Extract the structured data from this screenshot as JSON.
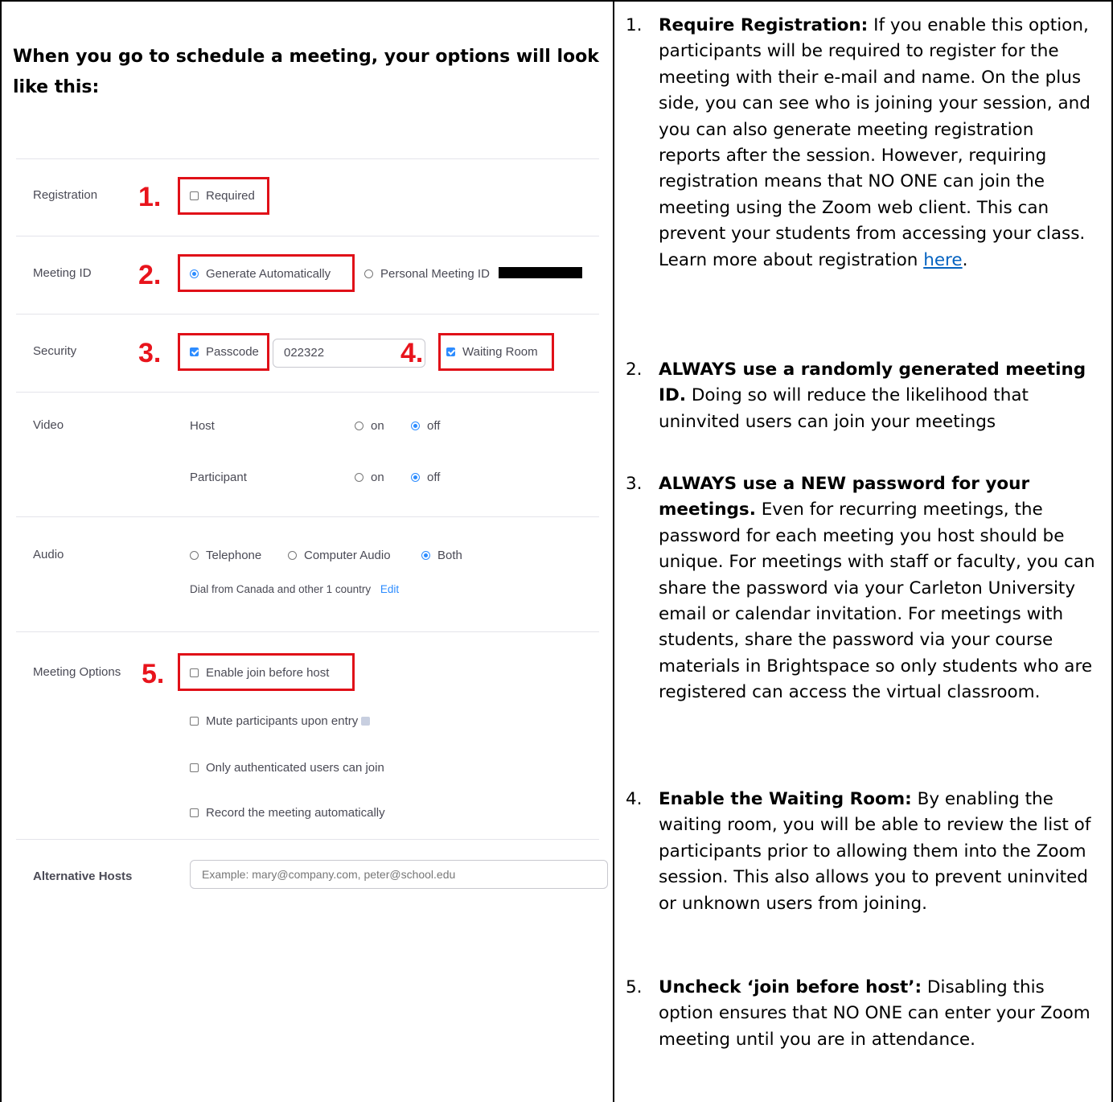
{
  "intro": "When you go to schedule a meeting, your options will look like this:",
  "zoom": {
    "registration": {
      "label": "Registration",
      "num": "1.",
      "option": "Required"
    },
    "meeting_id": {
      "label": "Meeting ID",
      "num": "2.",
      "auto": "Generate Automatically",
      "personal": "Personal Meeting ID"
    },
    "security": {
      "label": "Security",
      "num3": "3.",
      "passcode": "Passcode",
      "passcode_value": "022322",
      "num4": "4.",
      "waiting": "Waiting Room"
    },
    "video": {
      "label": "Video",
      "host": "Host",
      "participant": "Participant",
      "on": "on",
      "off": "off"
    },
    "audio": {
      "label": "Audio",
      "telephone": "Telephone",
      "computer": "Computer Audio",
      "both": "Both",
      "dial_text": "Dial from Canada and other 1 country",
      "edit": "Edit"
    },
    "meeting_options": {
      "label": "Meeting Options",
      "num": "5.",
      "join_before": "Enable join before host",
      "mute": "Mute participants upon entry",
      "auth": "Only authenticated users can join",
      "record": "Record the meeting automatically"
    },
    "alt_hosts": {
      "label": "Alternative Hosts",
      "placeholder": "Example: mary@company.com, peter@school.edu"
    }
  },
  "tips": [
    {
      "n": "1.",
      "title": "Require Registration:",
      "text": " If you enable this option, participants will be required to register for the meeting with their e-mail and name. On the plus side, you can see who is joining your session, and you can also generate meeting registration reports after the session. However, requiring registration means that NO ONE can join the meeting using the Zoom web client. This can prevent your students from accessing your class. Learn more about registration ",
      "link": "here",
      "after": "."
    },
    {
      "n": "2.",
      "title": "ALWAYS use a randomly generated meeting ID.",
      "text": " Doing so will reduce the likelihood that uninvited users can join your meetings"
    },
    {
      "n": "3.",
      "title": "ALWAYS use a NEW password for your meetings.",
      "text": " Even for recurring meetings, the password for each meeting you host should be unique. For meetings with staff or faculty, you can share the password via your Carleton University email or calendar invitation. For meetings with students, share the password via your course materials in Brightspace so only students who are registered can access the virtual classroom."
    },
    {
      "n": "4.",
      "title": "Enable the Waiting Room:",
      "text": " By enabling the waiting room, you will be able to review the list of participants prior to allowing them into the Zoom session. This also allows you to prevent uninvited or unknown users from joining."
    },
    {
      "n": "5.",
      "title": "Uncheck ‘join before host’:",
      "text": " Disabling this option ensures that NO ONE can enter your Zoom meeting until you are in attendance."
    }
  ]
}
